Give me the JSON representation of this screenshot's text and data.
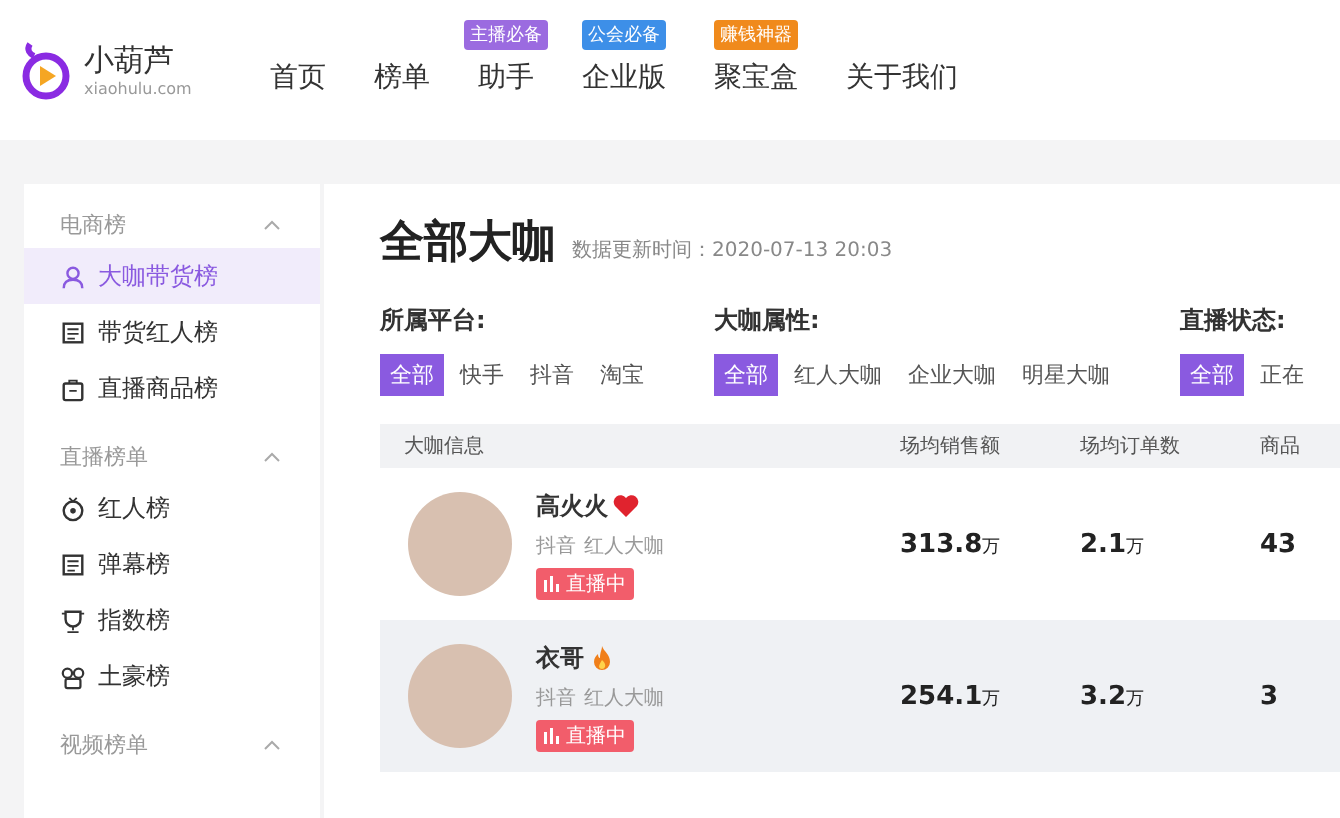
{
  "header": {
    "logo": {
      "name": "小葫芦",
      "domain": "xiaohulu.com"
    },
    "nav": [
      {
        "label": "首页"
      },
      {
        "label": "榜单"
      },
      {
        "label": "助手",
        "badge": "主播必备",
        "color": "#9b6be0"
      },
      {
        "label": "企业版",
        "badge": "公会必备",
        "color": "#3d8fe8"
      },
      {
        "label": "聚宝盒",
        "badge": "赚钱神器",
        "color": "#f08a1c"
      },
      {
        "label": "关于我们"
      }
    ]
  },
  "sidebar": {
    "sections": [
      {
        "title": "电商榜",
        "expanded": true,
        "items": [
          {
            "label": "大咖带货榜",
            "kind": "person",
            "selected": true
          },
          {
            "label": "带货红人榜",
            "kind": "list",
            "selected": false
          },
          {
            "label": "直播商品榜",
            "kind": "bag",
            "selected": false
          }
        ]
      },
      {
        "title": "直播榜单",
        "expanded": true,
        "items": [
          {
            "label": "红人榜",
            "kind": "medal",
            "selected": false
          },
          {
            "label": "弹幕榜",
            "kind": "list",
            "selected": false
          },
          {
            "label": "指数榜",
            "kind": "trophy",
            "selected": false
          },
          {
            "label": "土豪榜",
            "kind": "crown",
            "selected": false
          }
        ]
      },
      {
        "title": "视频榜单",
        "expanded": true
      }
    ]
  },
  "main": {
    "title": "全部大咖",
    "updated": "数据更新时间：2020-07-13 20:03",
    "filters": [
      {
        "label": "所属平台:",
        "options": [
          {
            "label": "全部",
            "selected": true
          },
          {
            "label": "快手",
            "selected": false
          },
          {
            "label": "抖音",
            "selected": false
          },
          {
            "label": "淘宝",
            "selected": false
          }
        ]
      },
      {
        "label": "大咖属性:",
        "options": [
          {
            "label": "全部",
            "selected": true
          },
          {
            "label": "红人大咖",
            "selected": false
          },
          {
            "label": "企业大咖",
            "selected": false
          },
          {
            "label": "明星大咖",
            "selected": false
          }
        ]
      },
      {
        "label": "直播状态:",
        "options": [
          {
            "label": "全部",
            "selected": true
          },
          {
            "label": "正在",
            "selected": false
          }
        ]
      }
    ],
    "table": {
      "columns": [
        "大咖信息",
        "场均销售额",
        "场均订单数",
        "商品"
      ],
      "rows": [
        {
          "name": "高火火",
          "kind": "heart",
          "platform": "抖音",
          "tag": "红人大咖",
          "live": true,
          "live_label": "直播中",
          "highlighted": false,
          "sales": "313.8",
          "sales_unit": "万",
          "orders": "2.1",
          "orders_unit": "万",
          "column_4": "43"
        },
        {
          "name": "衣哥",
          "kind": "fire",
          "platform": "抖音",
          "tag": "红人大咖",
          "live": true,
          "live_label": "直播中",
          "highlighted": true,
          "sales": "254.1",
          "sales_unit": "万",
          "orders": "3.2",
          "orders_unit": "万",
          "column_4": "3"
        }
      ]
    }
  }
}
